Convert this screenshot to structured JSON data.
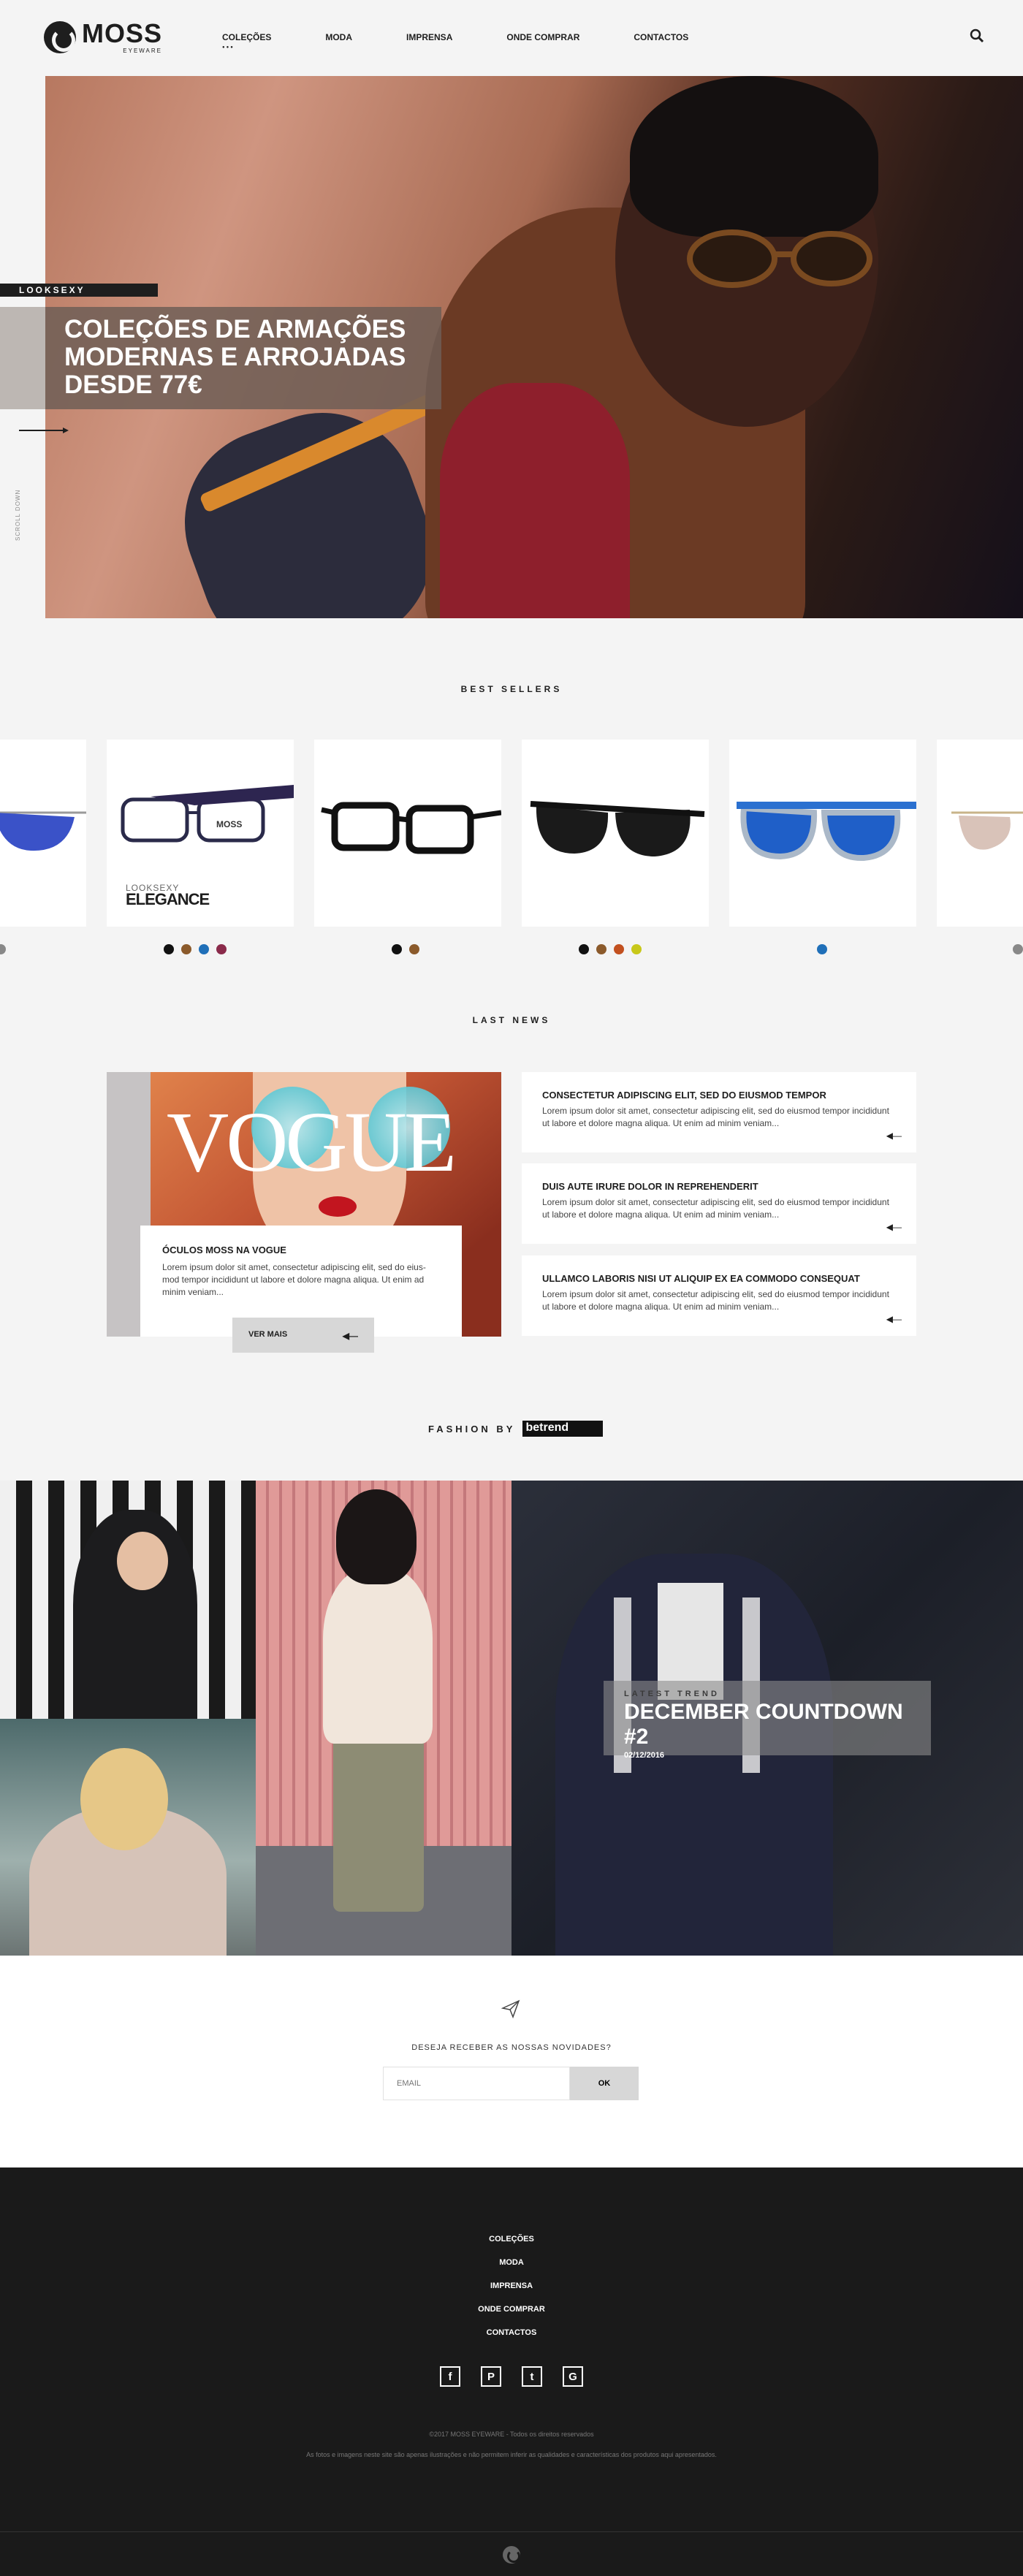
{
  "header": {
    "logo_name": "MOSS",
    "logo_sub": "EYEWARE",
    "nav": [
      "COLEÇÕES",
      "MODA",
      "IMPRENSA",
      "ONDE COMPRAR",
      "CONTACTOS"
    ]
  },
  "hero": {
    "tag": "LOOKSEXY",
    "headline": "COLEÇÕES DE ARMAÇÕES MODERNAS E ARROJADAS DESDE 77€",
    "scroll_label": "SCROLL DOWN",
    "counter": "0",
    "slides": 5
  },
  "best_sellers": {
    "title": "BEST SELLERS",
    "products": [
      {
        "name": "partial-left",
        "swatches": [
          "#888888"
        ]
      },
      {
        "name": "looksexy-elegance",
        "brand": "LOOKSEXY",
        "line": "ELEGANCE",
        "swatches": [
          "#111111",
          "#8b5a2b",
          "#1f6fb8",
          "#8a2a4a"
        ]
      },
      {
        "name": "black-rectangle",
        "swatches": [
          "#111111",
          "#8b5a2b"
        ]
      },
      {
        "name": "black-round",
        "swatches": [
          "#111111",
          "#8b5a2b",
          "#c2501f",
          "#c8c81a"
        ]
      },
      {
        "name": "blue-mirror",
        "swatches": [
          "#1f6fb8"
        ]
      },
      {
        "name": "partial-right",
        "swatches": [
          "#888888"
        ]
      }
    ]
  },
  "news": {
    "title": "LAST NEWS",
    "feature": {
      "magazine": "VOGUE",
      "title": "ÓCULOS MOSS NA VOGUE",
      "excerpt": "Lorem ipsum dolor sit amet, consectetur adipiscing elit, sed do eius-mod tempor incididunt ut labore et dolore magna aliqua. Ut enim ad minim veniam...",
      "button": "VER MAIS"
    },
    "items": [
      {
        "title": "CONSECTETUR ADIPISCING ELIT, SED DO EIUSMOD TEMPOR",
        "excerpt": "Lorem ipsum dolor sit amet, consectetur adipiscing elit, sed do eiusmod tempor incididunt ut labore et dolore magna aliqua. Ut enim ad minim veniam..."
      },
      {
        "title": "DUIS AUTE IRURE DOLOR IN REPREHENDERIT",
        "excerpt": "Lorem ipsum dolor sit amet, consectetur adipiscing elit, sed do eiusmod tempor incididunt ut labore et dolore magna aliqua. Ut enim ad minim veniam..."
      },
      {
        "title": "ULLAMCO LABORIS NISI UT ALIQUIP EX EA COMMODO CONSEQUAT",
        "excerpt": "Lorem ipsum dolor sit amet, consectetur adipiscing elit, sed do eiusmod tempor incididunt ut labore et dolore magna aliqua. Ut enim ad minim veniam..."
      }
    ]
  },
  "fashion": {
    "label": "FASHION BY",
    "brand": "betrend",
    "trend_label": "LATEST TREND",
    "trend_title": "DECEMBER COUNTDOWN #2",
    "trend_date": "02/12/2016"
  },
  "newsletter": {
    "question": "DESEJA RECEBER AS NOSSAS NOVIDADES?",
    "placeholder": "EMAIL",
    "button": "OK"
  },
  "footer": {
    "links": [
      "COLEÇÕES",
      "MODA",
      "IMPRENSA",
      "ONDE COMPRAR",
      "CONTACTOS"
    ],
    "socials": [
      "f",
      "P",
      "t",
      "G"
    ],
    "copyright": "©2017 MOSS EYEWARE - Todos os direitos reservados",
    "disclaimer": "As fotos e imagens neste site são apenas ilustrações e não permitem inferir as qualidades e características dos produtos aqui apresentados."
  },
  "colors": {
    "background": "#f4f4f4",
    "dark": "#1e1e1e",
    "footer": "#1a1a1a",
    "button_grey": "#d7d7d7"
  }
}
